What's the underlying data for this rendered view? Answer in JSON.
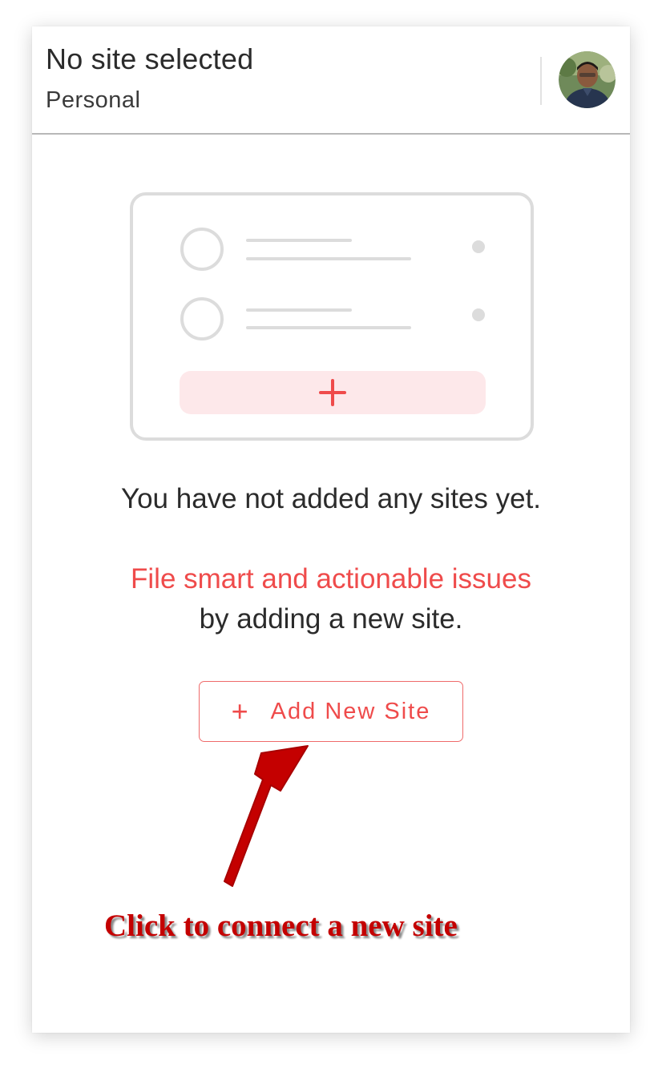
{
  "header": {
    "site_title": "No site selected",
    "site_subtitle": "Personal",
    "avatar_icon": "user-avatar"
  },
  "empty_state": {
    "illustration_icon": "site-list-placeholder-illustration",
    "message": "You have not added any sites yet.",
    "promo_accent": "File smart and actionable issues",
    "promo_rest": "by adding a new site."
  },
  "add_button": {
    "icon": "plus-icon",
    "plus_glyph": "+",
    "label": "Add New Site"
  },
  "annotation": {
    "arrow_icon": "pointer-arrow",
    "callout": "Click to connect a new site"
  },
  "colors": {
    "accent": "#ef4b4b",
    "annotation_red": "#c40000",
    "placeholder_gray": "#dcdcdc",
    "placeholder_pink": "#fde8ea"
  }
}
